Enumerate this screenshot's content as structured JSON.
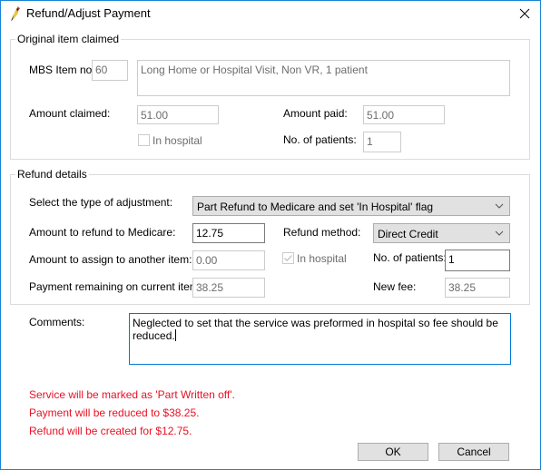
{
  "window": {
    "title": "Refund/Adjust Payment",
    "icon": "finch-bird-icon",
    "close_icon": "close-icon"
  },
  "original": {
    "legend": "Original item claimed",
    "mbs_item_label": "MBS Item no:",
    "mbs_item_value": "60",
    "description": "Long Home or Hospital Visit, Non VR, 1 patient",
    "amount_claimed_label": "Amount claimed:",
    "amount_claimed_value": "51.00",
    "amount_paid_label": "Amount paid:",
    "amount_paid_value": "51.00",
    "in_hospital_label": "In hospital",
    "in_hospital_checked": false,
    "patients_label": "No. of patients:",
    "patients_value": "1"
  },
  "refund": {
    "legend": "Refund details",
    "adjustment_type_label": "Select the type of adjustment:",
    "adjustment_type_value": "Part Refund to Medicare and set 'In Hospital' flag",
    "refund_amount_label": "Amount to refund to Medicare:",
    "refund_amount_value": "12.75",
    "refund_method_label": "Refund method:",
    "refund_method_value": "Direct Credit",
    "assign_amount_label": "Amount to assign to another item:",
    "assign_amount_value": "0.00",
    "in_hospital_label": "In hospital",
    "in_hospital_checked": true,
    "patients_label": "No. of patients:",
    "patients_value": "1",
    "remaining_label": "Payment remaining on current item:",
    "remaining_value": "38.25",
    "new_fee_label": "New fee:",
    "new_fee_value": "38.25"
  },
  "comments": {
    "label": "Comments:",
    "value": "Neglected to set that the service was preformed in hospital so fee should be reduced."
  },
  "messages": [
    "Service will be marked as 'Part Written off'.",
    "Payment will be reduced to $38.25.",
    "Refund will be created for $12.75."
  ],
  "buttons": {
    "ok": "OK",
    "cancel": "Cancel"
  },
  "colors": {
    "accent": "#0078d7",
    "window_border": "#1883d7",
    "message_red": "#e81123"
  }
}
